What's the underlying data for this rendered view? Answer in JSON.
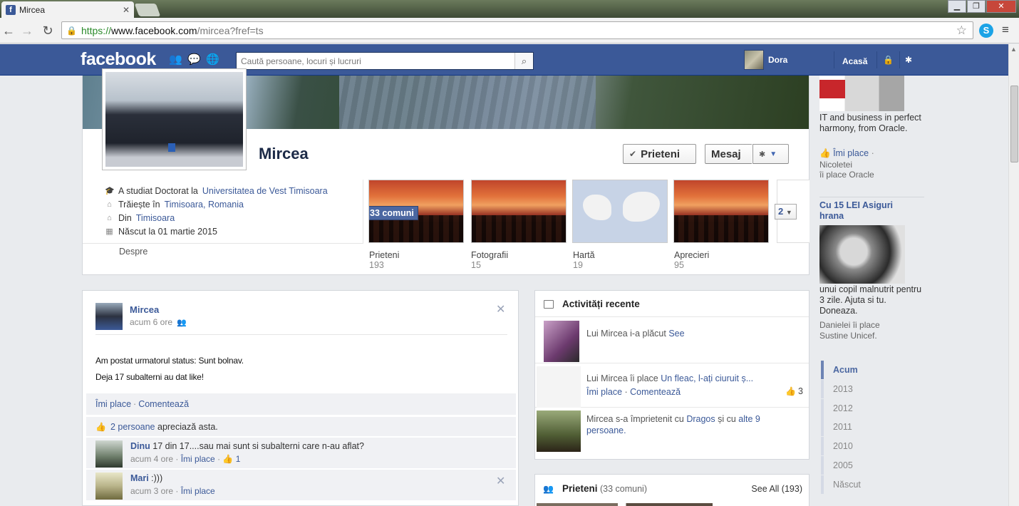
{
  "browser": {
    "tab_title": "Mircea",
    "url_scheme": "https://",
    "url_host": "www.facebook.com",
    "url_path": "/mircea?fref=ts"
  },
  "fb": {
    "logo": "facebook",
    "search_placeholder": "Caută persoane, locuri și lucruri",
    "user_name": "Dora",
    "home": "Acasă"
  },
  "profile": {
    "name": "Mircea",
    "btn_friends": "Prieteni",
    "btn_message": "Mesaj",
    "info": [
      {
        "pre": "A studiat Doctorat la ",
        "link": "Universitatea de Vest Timisoara",
        "post": ""
      },
      {
        "pre": "Trăiește în ",
        "link": "Timisoara, Romania",
        "post": ""
      },
      {
        "pre": "Din ",
        "link": "Timisoara",
        "post": ""
      },
      {
        "pre": "Născut la 01 martie 2015",
        "link": "",
        "post": ""
      }
    ],
    "about": "Despre",
    "common_badge": "33 comuni",
    "thumbs": [
      {
        "label": "Prieteni",
        "count": "193"
      },
      {
        "label": "Fotografii",
        "count": "15"
      },
      {
        "label": "Hartă",
        "count": "19"
      },
      {
        "label": "Aprecieri",
        "count": "95"
      }
    ],
    "more": "2"
  },
  "post": {
    "author": "Mircea",
    "time": "acum 6 ore",
    "line1": "Am postat urmatorul status: Sunt bolnav.",
    "line2": "Deja 17 subalterni au dat like!",
    "like": "Îmi place",
    "comment": "Comentează",
    "likes_link": "2 persoane",
    "likes_text": " apreciază asta.",
    "comments": [
      {
        "name": "Dinu",
        "text": " 17 din 17....sau mai sunt si subalterni care n-au aflat?",
        "time": "acum 4 ore",
        "like": "Îmi place",
        "likes": "1"
      },
      {
        "name": "Mari",
        "text": " :)))",
        "time": "acum 3 ore",
        "like": "Îmi place",
        "likes": ""
      }
    ]
  },
  "activity": {
    "title": "Activități recente",
    "items": [
      {
        "pre": "Lui Mircea i-a plăcut ",
        "link": "See",
        "post": ""
      },
      {
        "pre": "Lui Mircea îi place ",
        "link": "Un fleac, l-ați ciuruit ș...",
        "post": "",
        "like": "Îmi place",
        "comment": "Comentează",
        "count": "3"
      },
      {
        "pre": "Mircea s-a împrietenit cu ",
        "link": "Dragos",
        "mid": " și cu ",
        "link2": "alte 9",
        "post": "persoane."
      }
    ]
  },
  "friends_box": {
    "title": "Prieteni",
    "common": " (33 comuni)",
    "see_all": "See All (193)"
  },
  "ads": {
    "ad1_text": "IT and business in perfect harmony, from Oracle.",
    "ad1_like": "Îmi place",
    "ad1_social1": "Nicoletei",
    "ad1_social2": "îi place Oracle",
    "ad2_title": "Cu 15 LEI Asiguri hrana",
    "ad2_text": "unui copil malnutrit pentru 3 zile. Ajuta si tu. Doneaza.",
    "ad2_social1": "Danielei îi place",
    "ad2_social2": "Sustine Unicef."
  },
  "timeline": [
    "Acum",
    "2013",
    "2012",
    "2011",
    "2010",
    "2005",
    "Născut"
  ]
}
